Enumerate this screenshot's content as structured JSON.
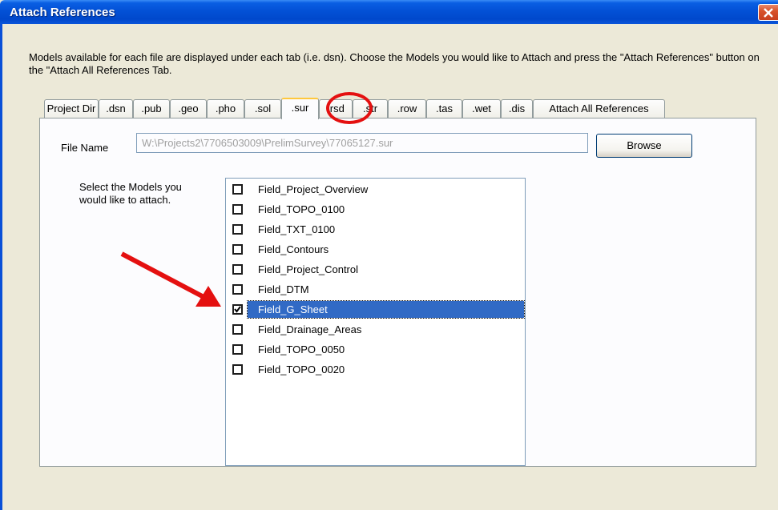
{
  "window": {
    "title": "Attach References"
  },
  "description": "Models available for each file are displayed under each tab (i.e. dsn).  Choose the Models you would like to Attach and press the \"Attach References\" button on the \"Attach All References Tab.",
  "tabs": [
    {
      "label": "Project Dir",
      "active": false
    },
    {
      "label": ".dsn",
      "active": false
    },
    {
      "label": ".pub",
      "active": false
    },
    {
      "label": ".geo",
      "active": false
    },
    {
      "label": ".pho",
      "active": false
    },
    {
      "label": ".sol",
      "active": false
    },
    {
      "label": ".sur",
      "active": true
    },
    {
      "label": ".rsd",
      "active": false
    },
    {
      "label": ".str",
      "active": false
    },
    {
      "label": ".row",
      "active": false
    },
    {
      "label": ".tas",
      "active": false
    },
    {
      "label": ".wet",
      "active": false
    },
    {
      "label": ".dis",
      "active": false
    },
    {
      "label": "Attach All References",
      "active": false
    }
  ],
  "file_name": {
    "label": "File Name",
    "value": "W:\\Projects2\\7706503009\\PrelimSurvey\\77065127.sur"
  },
  "browse_button": "Browse",
  "models_label_line1": "Select the Models you",
  "models_label_line2": "would like to attach.",
  "models": [
    {
      "name": "Field_Project_Overview",
      "checked": false,
      "selected": false
    },
    {
      "name": "Field_TOPO_0100",
      "checked": false,
      "selected": false
    },
    {
      "name": "Field_TXT_0100",
      "checked": false,
      "selected": false
    },
    {
      "name": "Field_Contours",
      "checked": false,
      "selected": false
    },
    {
      "name": "Field_Project_Control",
      "checked": false,
      "selected": false
    },
    {
      "name": "Field_DTM",
      "checked": false,
      "selected": false
    },
    {
      "name": "Field_G_Sheet",
      "checked": true,
      "selected": true
    },
    {
      "name": "Field_Drainage_Areas",
      "checked": false,
      "selected": false
    },
    {
      "name": "Field_TOPO_0050",
      "checked": false,
      "selected": false
    },
    {
      "name": "Field_TOPO_0020",
      "checked": false,
      "selected": false
    }
  ],
  "colors": {
    "titlebar": "#0351d6",
    "selection": "#316ac5",
    "annotation": "#e41010",
    "active_tab_accent": "#ffc83c"
  },
  "icons": {
    "close": "close-icon",
    "checkbox": "checkbox-icon",
    "annotation_arrow": "arrow-icon"
  }
}
